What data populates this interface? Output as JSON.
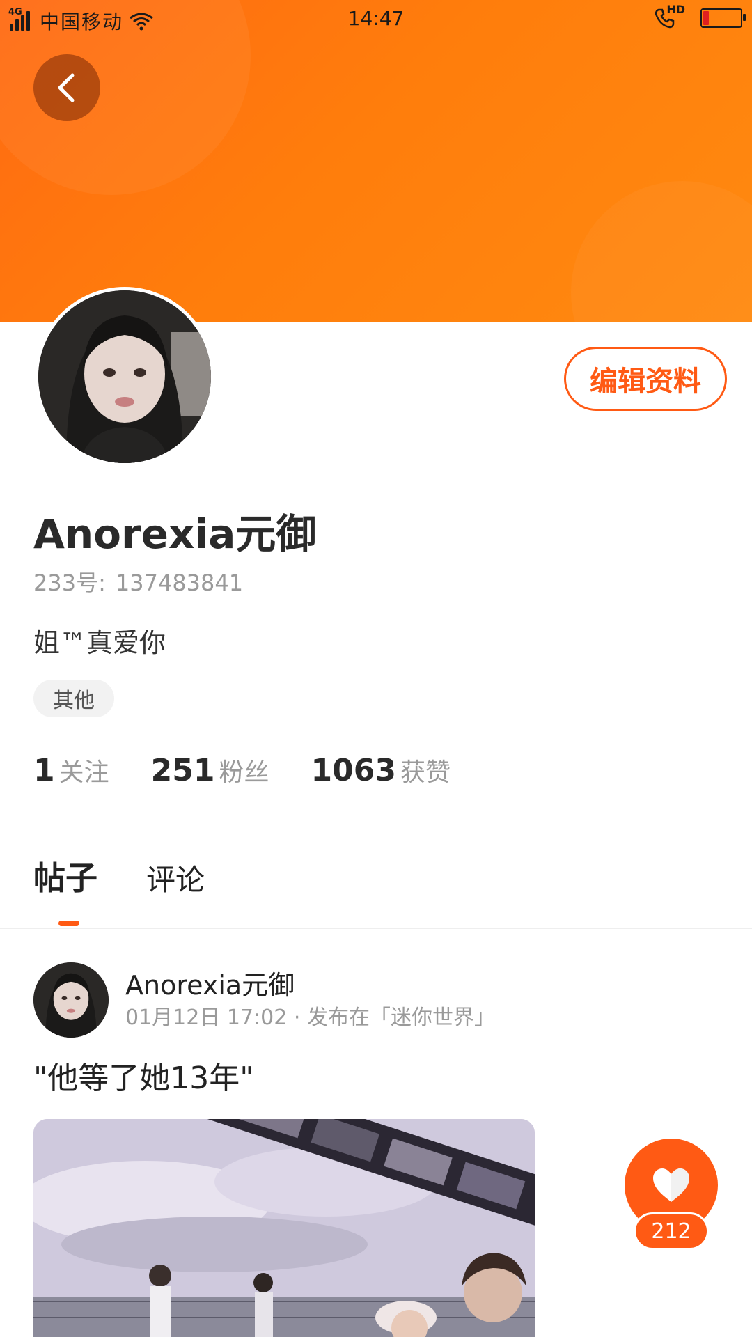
{
  "status_bar": {
    "network_type": "4G",
    "carrier": "中国移动",
    "time": "14:47",
    "hd_label": "HD",
    "battery_color": "#e02020"
  },
  "header": {
    "back_icon": "chevron-left-icon",
    "banner_color": "#ff7a10"
  },
  "profile": {
    "username": "Anorexia元御",
    "id_label": "233号:",
    "id_value": "137483841",
    "bio": "姐™真爱你",
    "tag": "其他",
    "edit_button_label": "编辑资料",
    "stats": [
      {
        "value": "1",
        "label": "关注"
      },
      {
        "value": "251",
        "label": "粉丝"
      },
      {
        "value": "1063",
        "label": "获赞"
      }
    ]
  },
  "tabs": [
    {
      "label": "帖子",
      "active": true
    },
    {
      "label": "评论",
      "active": false
    }
  ],
  "post": {
    "author": "Anorexia元御",
    "meta": "01月12日 17:02 · 发布在「迷你世界」",
    "title": "\"他等了她13年\""
  },
  "like_fab": {
    "icon": "heart-icon",
    "count": "212"
  },
  "accent_color": "#ff5a14"
}
